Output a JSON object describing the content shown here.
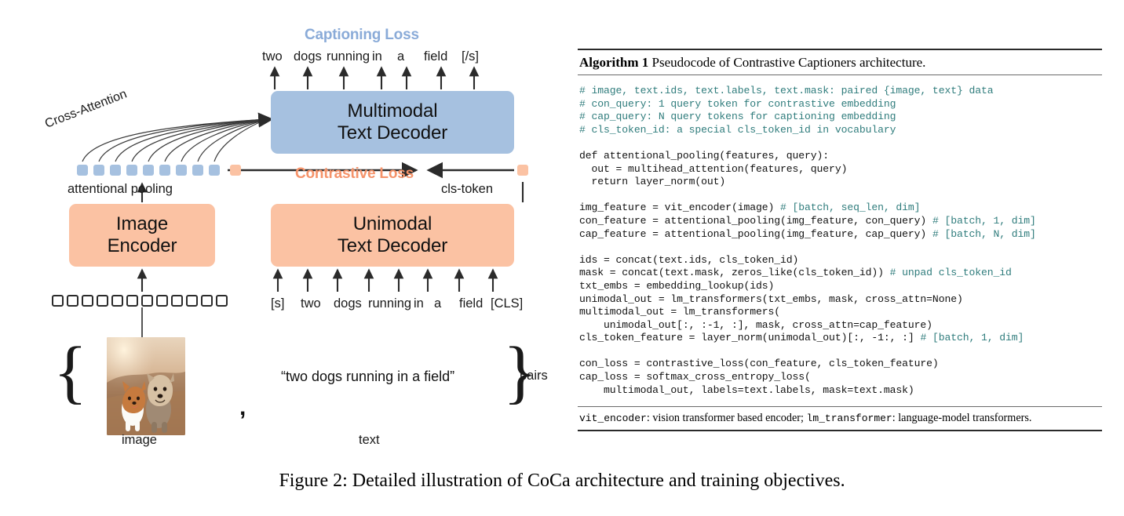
{
  "figure": {
    "caption": "Figure 2: Detailed illustration of CoCa architecture and training objectives."
  },
  "colors": {
    "blue_block": "#a6c1e0",
    "orange_block": "#fbc2a3",
    "captioning_loss_text": "#8aabd8",
    "contrastive_loss_text": "#f5936a",
    "arrow": "#2b2b2b"
  },
  "diagram": {
    "captioning_loss_label": "Captioning Loss",
    "contrastive_loss_label": "Contrastive Loss",
    "cross_attention_label": "Cross-Attention",
    "attentional_pooling_label": "attentional pooling",
    "cls_token_label": "cls-token",
    "output_tokens": [
      "two",
      "dogs",
      "running",
      "in",
      "a",
      "field",
      "[/s]"
    ],
    "input_tokens": [
      "[s]",
      "two",
      "dogs",
      "running",
      "in",
      "a",
      "field",
      "[CLS]"
    ],
    "multimodal_decoder": {
      "line1": "Multimodal",
      "line2": "Text Decoder"
    },
    "image_encoder": {
      "line1": "Image",
      "line2": "Encoder"
    },
    "unimodal_decoder": {
      "line1": "Unimodal",
      "line2": "Text Decoder"
    },
    "pooling_tokens_blue_count": 9,
    "pooling_tokens_cls_count": 1,
    "image_patch_count": 12,
    "caption_quote": "“two dogs running in a field”",
    "comma": ",",
    "image_label": "image",
    "text_label": "text",
    "pairs_label": "pairs",
    "brace_left": "{",
    "brace_right": "}"
  },
  "algorithm": {
    "title_keyword": "Algorithm 1",
    "title_rest": " Pseudocode of Contrastive Captioners architecture.",
    "code_lines": [
      {
        "text": "# image, text.ids, text.labels, text.mask: paired {image, text} data",
        "comment": true
      },
      {
        "text": "# con_query: 1 query token for contrastive embedding",
        "comment": true
      },
      {
        "text": "# cap_query: N query tokens for captioning embedding",
        "comment": true
      },
      {
        "text": "# cls_token_id: a special cls_token_id in vocabulary",
        "comment": true
      },
      {
        "text": "",
        "comment": false
      },
      {
        "text": "def attentional_pooling(features, query):",
        "comment": false
      },
      {
        "text": "  out = multihead_attention(features, query)",
        "comment": false
      },
      {
        "text": "  return layer_norm(out)",
        "comment": false
      },
      {
        "text": "",
        "comment": false
      },
      {
        "code": "img_feature = vit_encoder(image) ",
        "cmt": "# [batch, seq_len, dim]"
      },
      {
        "code": "con_feature = attentional_pooling(img_feature, con_query) ",
        "cmt": "# [batch, 1, dim]"
      },
      {
        "code": "cap_feature = attentional_pooling(img_feature, cap_query) ",
        "cmt": "# [batch, N, dim]"
      },
      {
        "text": "",
        "comment": false
      },
      {
        "text": "ids = concat(text.ids, cls_token_id)",
        "comment": false
      },
      {
        "code": "mask = concat(text.mask, zeros_like(cls_token_id)) ",
        "cmt": "# unpad cls_token_id"
      },
      {
        "text": "txt_embs = embedding_lookup(ids)",
        "comment": false
      },
      {
        "text": "unimodal_out = lm_transformers(txt_embs, mask, cross_attn=None)",
        "comment": false
      },
      {
        "text": "multimodal_out = lm_transformers(",
        "comment": false
      },
      {
        "text": "    unimodal_out[:, :-1, :], mask, cross_attn=cap_feature)",
        "comment": false
      },
      {
        "code": "cls_token_feature = layer_norm(unimodal_out)[:, -1:, :] ",
        "cmt": "# [batch, 1, dim]"
      },
      {
        "text": "",
        "comment": false
      },
      {
        "text": "con_loss = contrastive_loss(con_feature, cls_token_feature)",
        "comment": false
      },
      {
        "text": "cap_loss = softmax_cross_entropy_loss(",
        "comment": false
      },
      {
        "text": "    multimodal_out, labels=text.labels, mask=text.mask)",
        "comment": false
      }
    ],
    "footnote_parts": [
      {
        "text": "vit_encoder",
        "mono": true
      },
      {
        "text": ": vision transformer based encoder; ",
        "mono": false
      },
      {
        "text": "lm_transformer",
        "mono": true
      },
      {
        "text": ": language-model transformers.",
        "mono": false
      }
    ]
  }
}
